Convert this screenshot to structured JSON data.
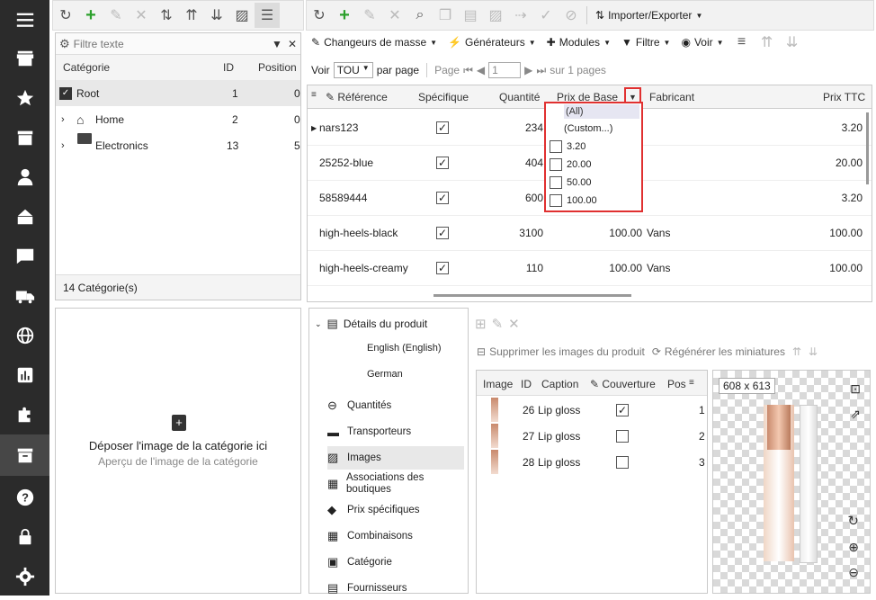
{
  "sidebar": {
    "icons": [
      "menu-icon",
      "store-icon",
      "star-icon",
      "box-icon",
      "user-icon",
      "basket-icon",
      "chat-icon",
      "truck-icon",
      "globe-icon",
      "chart-icon",
      "puzzle-icon",
      "archive-icon",
      "help-icon",
      "lock-icon",
      "gear-icon"
    ]
  },
  "category_panel": {
    "filter_placeholder": "Filtre texte",
    "columns": [
      "Catégorie",
      "ID",
      "Position"
    ],
    "rows": [
      {
        "name": "Root",
        "id": "1",
        "pos": "0"
      },
      {
        "name": "Home",
        "id": "2",
        "pos": "0"
      },
      {
        "name": "Electronics",
        "id": "13",
        "pos": "5"
      }
    ],
    "footer": "14 Catégorie(s)"
  },
  "drop_zone": {
    "title": "Déposer l'image de la catégorie ici",
    "subtitle": "Aperçu de l'image de la catégorie"
  },
  "main_toolbar": {
    "import_export": "Importer/Exporter"
  },
  "toolbar2": {
    "bulk": "Changeurs de masse",
    "generators": "Générateurs",
    "modules": "Modules",
    "filter": "Filtre",
    "view": "Voir"
  },
  "pager": {
    "show_label": "Voir",
    "per_page_value": "TOU",
    "per_page_label": "par page",
    "page_label": "Page",
    "page_value": "1",
    "of_pages": "sur 1 pages"
  },
  "product_grid": {
    "columns": {
      "ref": "Référence",
      "specific": "Spécifique",
      "qty": "Quantité",
      "base_price": "Prix de Base",
      "maker": "Fabricant",
      "price_ttc": "Prix TTC"
    },
    "rows": [
      {
        "ref": "nars123",
        "specific": true,
        "qty": "234",
        "base": "",
        "maker": "",
        "ttc": "3.20"
      },
      {
        "ref": "25252-blue",
        "specific": true,
        "qty": "404",
        "base": "",
        "maker": "",
        "ttc": "20.00"
      },
      {
        "ref": "58589444",
        "specific": true,
        "qty": "600",
        "base": "",
        "maker": "",
        "ttc": "3.20"
      },
      {
        "ref": "high-heels-black",
        "specific": true,
        "qty": "3100",
        "base": "100.00",
        "maker": "Vans",
        "ttc": "100.00"
      },
      {
        "ref": "high-heels-creamy",
        "specific": true,
        "qty": "110",
        "base": "100.00",
        "maker": "Vans",
        "ttc": "100.00"
      }
    ]
  },
  "filter_dropdown": {
    "all": "(All)",
    "custom": "(Custom...)",
    "options": [
      "3.20",
      "20.00",
      "50.00",
      "100.00"
    ]
  },
  "details_tree": {
    "root": "Détails du produit",
    "langs": [
      "English (English)",
      "German"
    ],
    "items": [
      "Quantités",
      "Transporteurs",
      "Images",
      "Associations des boutiques",
      "Prix spécifiques",
      "Combinaisons",
      "Catégorie",
      "Fournisseurs"
    ]
  },
  "images_panel": {
    "delete_label": "Supprimer les images du produit",
    "regen_label": "Régénérer les miniatures",
    "columns": {
      "image": "Image",
      "id": "ID",
      "caption": "Caption",
      "cover": "Couverture",
      "pos": "Pos"
    },
    "rows": [
      {
        "id": "26",
        "caption": "Lip gloss",
        "cover": true,
        "pos": "1"
      },
      {
        "id": "27",
        "caption": "Lip gloss",
        "cover": false,
        "pos": "2"
      },
      {
        "id": "28",
        "caption": "Lip gloss",
        "cover": false,
        "pos": "3"
      }
    ],
    "preview_size": "608 x 613"
  },
  "colors": {
    "sidebar": "#2b2b2b",
    "highlight": "#e03030",
    "accent_green": "#2ca02c"
  }
}
